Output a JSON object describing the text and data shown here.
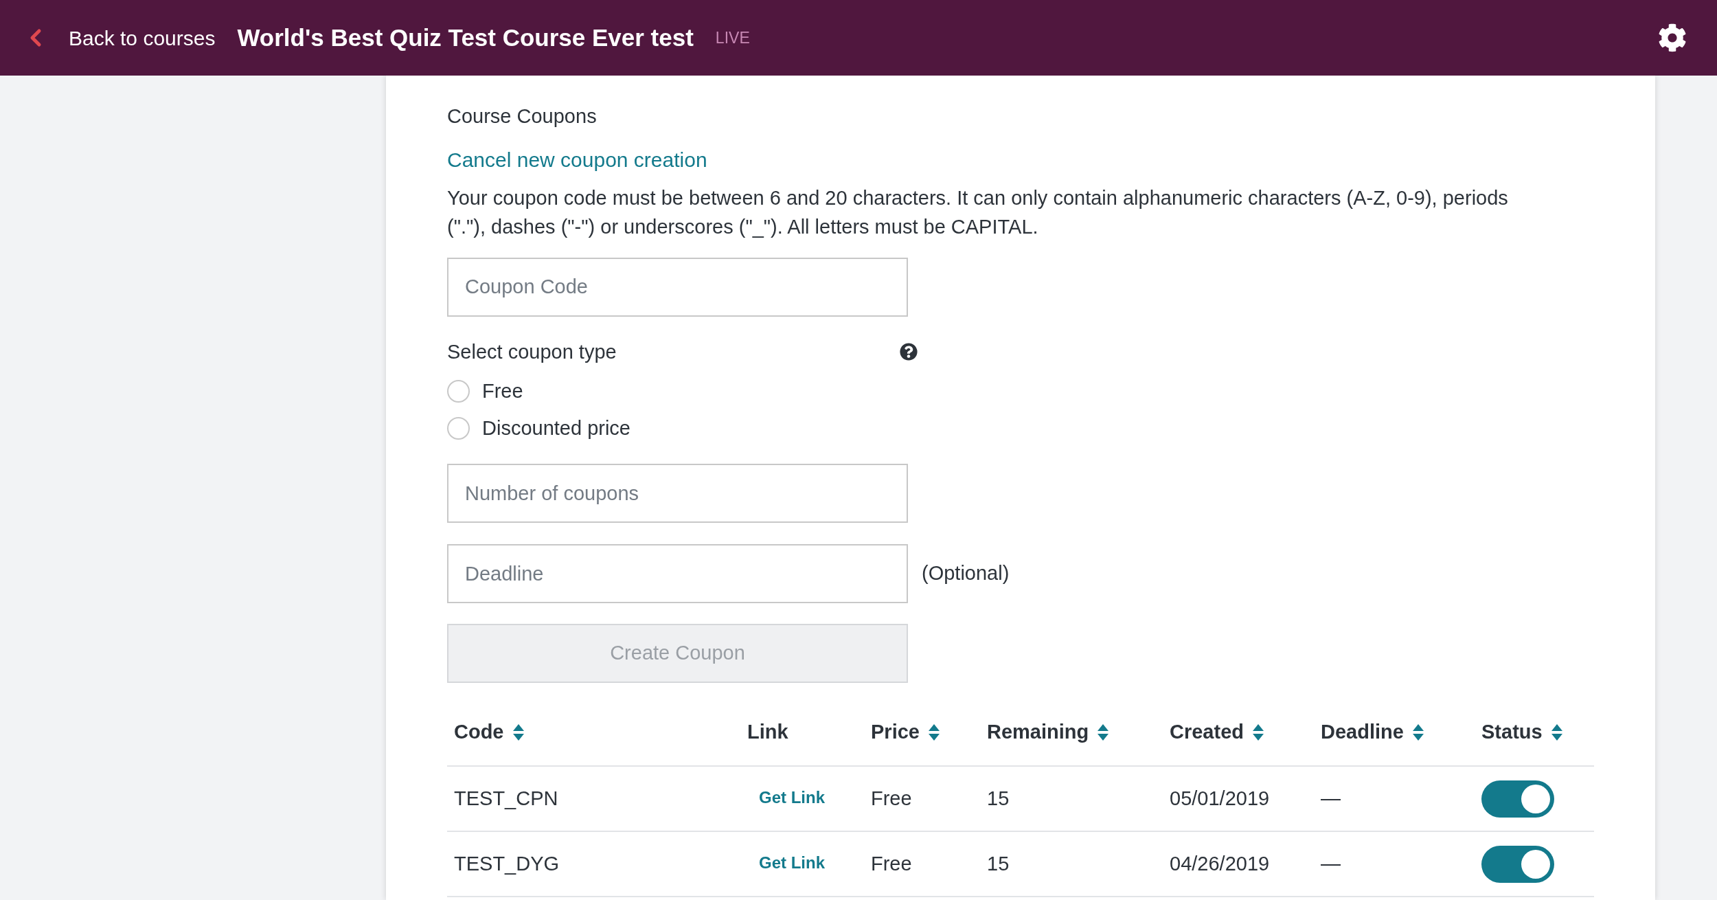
{
  "header": {
    "back_label": "Back to courses",
    "title": "World's Best Quiz Test Course Ever test",
    "status": "LIVE"
  },
  "section_title": "Course Coupons",
  "cancel_link": "Cancel new coupon creation",
  "rules_text": "Your coupon code must be between 6 and 20 characters. It can only contain alphanumeric characters (A-Z, 0-9), periods (\".\"), dashes (\"-\") or underscores (\"_\"). All letters must be CAPITAL.",
  "coupon_code_field": {
    "placeholder": "Coupon Code"
  },
  "coupon_type": {
    "label": "Select coupon type",
    "options": [
      {
        "label": "Free",
        "selected": false
      },
      {
        "label": "Discounted price",
        "selected": false
      }
    ]
  },
  "number_field": {
    "placeholder": "Number of coupons"
  },
  "deadline_field": {
    "placeholder": "Deadline",
    "note": "(Optional)"
  },
  "create_button": {
    "label": "Create Coupon",
    "disabled": true
  },
  "table": {
    "columns": [
      {
        "label": "Code",
        "sortable": true
      },
      {
        "label": "Link",
        "sortable": false
      },
      {
        "label": "Price",
        "sortable": true
      },
      {
        "label": "Remaining",
        "sortable": true
      },
      {
        "label": "Created",
        "sortable": true
      },
      {
        "label": "Deadline",
        "sortable": true
      },
      {
        "label": "Status",
        "sortable": true
      }
    ],
    "rows": [
      {
        "code": "TEST_CPN",
        "link": "Get Link",
        "price": "Free",
        "remaining": "15",
        "created": "05/01/2019",
        "deadline": "—",
        "on": true
      },
      {
        "code": "TEST_DYG",
        "link": "Get Link",
        "price": "Free",
        "remaining": "15",
        "created": "04/26/2019",
        "deadline": "—",
        "on": true
      }
    ]
  }
}
